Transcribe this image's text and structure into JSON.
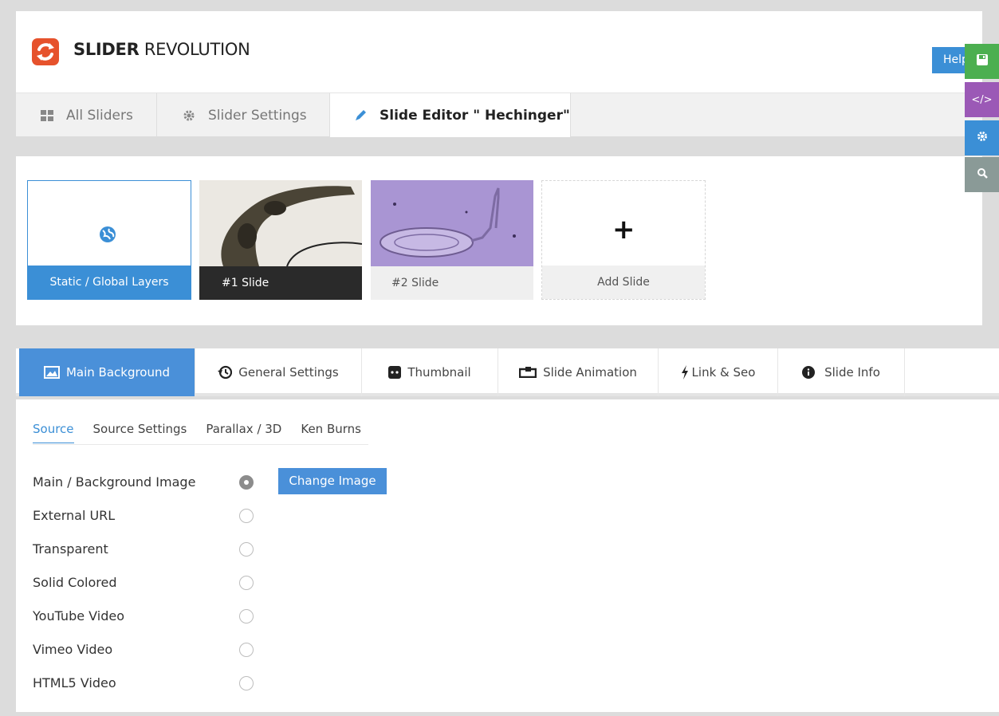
{
  "header": {
    "brand_bold": "SLIDER",
    "brand_light": " REVOLUTION",
    "help_label": "Help"
  },
  "top_tabs": [
    {
      "label": "All Sliders",
      "icon": "grid-icon"
    },
    {
      "label": "Slider Settings",
      "icon": "gear-icon"
    },
    {
      "label": "Slide Editor \" Hechinger\"",
      "icon": "pencil-icon"
    }
  ],
  "slides": {
    "static_label": "Static / Global Layers",
    "slide1_label": "#1 Slide",
    "slide2_label": "#2 Slide",
    "add_label": "Add Slide"
  },
  "bottom_tabs": [
    {
      "label": "Main Background",
      "icon": "image-icon"
    },
    {
      "label": "General Settings",
      "icon": "history-icon"
    },
    {
      "label": "Thumbnail",
      "icon": "thumbnail-icon"
    },
    {
      "label": "Slide Animation",
      "icon": "loop-icon"
    },
    {
      "label": "Link & Seo",
      "icon": "bolt-icon"
    },
    {
      "label": "Slide Info",
      "icon": "info-icon"
    }
  ],
  "sub_tabs": [
    "Source",
    "Source Settings",
    "Parallax / 3D",
    "Ken Burns"
  ],
  "source_options": [
    {
      "label": "Main / Background Image",
      "checked": true
    },
    {
      "label": "External URL",
      "checked": false
    },
    {
      "label": "Transparent",
      "checked": false
    },
    {
      "label": "Solid Colored",
      "checked": false
    },
    {
      "label": "YouTube Video",
      "checked": false
    },
    {
      "label": "Vimeo Video",
      "checked": false
    },
    {
      "label": "HTML5 Video",
      "checked": false
    }
  ],
  "change_image_label": "Change Image",
  "right_toolbar": [
    {
      "icon": "save-icon",
      "color": "#4caf50"
    },
    {
      "icon": "code-icon",
      "label": "</>",
      "color": "#9b59b6"
    },
    {
      "icon": "gear-icon",
      "color": "#3b8fd6"
    },
    {
      "icon": "search-icon",
      "color": "#8a9a97"
    }
  ],
  "colors": {
    "accent": "#4a90d9",
    "brand": "#e6522c"
  }
}
